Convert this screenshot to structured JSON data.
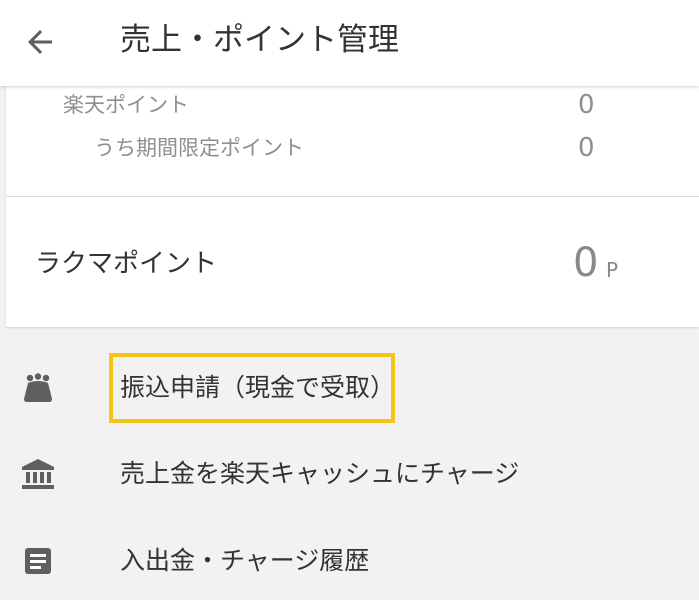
{
  "header": {
    "title": "売上・ポイント管理",
    "back_icon": "arrow-left-icon"
  },
  "points_card": {
    "rakuten_point_label": "楽天ポイント",
    "rakuten_point_value": "0",
    "limited_point_label": "うち期間限定ポイント",
    "limited_point_value": "0",
    "rakuma_point_label": "ラクマポイント",
    "rakuma_point_value": "0",
    "rakuma_point_unit": "P"
  },
  "menu": {
    "items": [
      {
        "label": "振込申請（現金で受取）",
        "icon": "purse-icon"
      },
      {
        "label": "売上金を楽天キャッシュにチャージ",
        "icon": "bank-icon"
      },
      {
        "label": "入出金・チャージ履歴",
        "icon": "document-icon"
      }
    ]
  },
  "colors": {
    "highlight": "#f6c417",
    "icon": "#5f5f5f",
    "background": "#f2f2f2"
  }
}
